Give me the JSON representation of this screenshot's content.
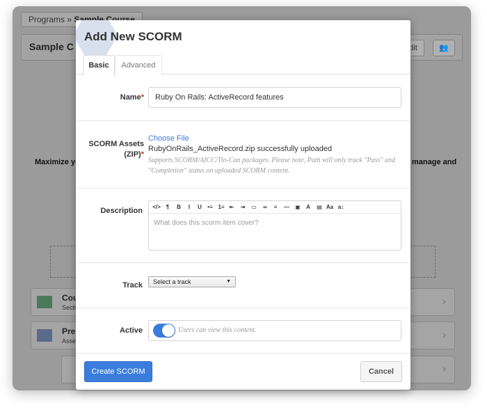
{
  "background": {
    "breadcrumb": {
      "root": "Programs",
      "separator": "»",
      "current": "Sample Course"
    },
    "header_title": "Sample C",
    "edit_button": "dit",
    "text_left": "Maximize yo",
    "text_right": "manage and",
    "rows": [
      {
        "title": "Cou",
        "subtitle": "Secti"
      },
      {
        "title": "Pre",
        "subtitle": "Asse"
      }
    ]
  },
  "modal": {
    "title": "Add New SCORM",
    "tabs": [
      {
        "label": "Basic",
        "active": true
      },
      {
        "label": "Advanced",
        "active": false
      }
    ],
    "name": {
      "label": "Name",
      "required_mark": "*",
      "value": "Ruby On Rails: ActiveRecord features"
    },
    "scorm_assets": {
      "label_line1": "SCORM Assets",
      "label_line2": "(ZIP)",
      "required_mark": "*",
      "choose_file": "Choose File",
      "uploaded_text": "RubyOnRails_ActiveRecord.zip successfully uploaded",
      "help_text": "Supports SCORM/AICC/Tin-Can packages. Please note, Path will only track \"Pass\" and \"Completion\" status on uploaded SCORM content."
    },
    "description": {
      "label": "Description",
      "placeholder": "What does this scorm item cover?",
      "toolbar": [
        "</>",
        "¶",
        "B",
        "I",
        "U",
        "•≡",
        "1≡",
        "⇤",
        "⇥",
        "▭",
        "∞",
        "≡",
        "—",
        "▣",
        "A",
        "▤",
        "Aa",
        "a↕"
      ]
    },
    "track": {
      "label": "Track",
      "selected": "Select a track",
      "arrow": "▼"
    },
    "active": {
      "label": "Active",
      "enabled": true,
      "hint": "Users can view this content."
    },
    "buttons": {
      "submit": "Create SCORM",
      "cancel": "Cancel"
    }
  }
}
